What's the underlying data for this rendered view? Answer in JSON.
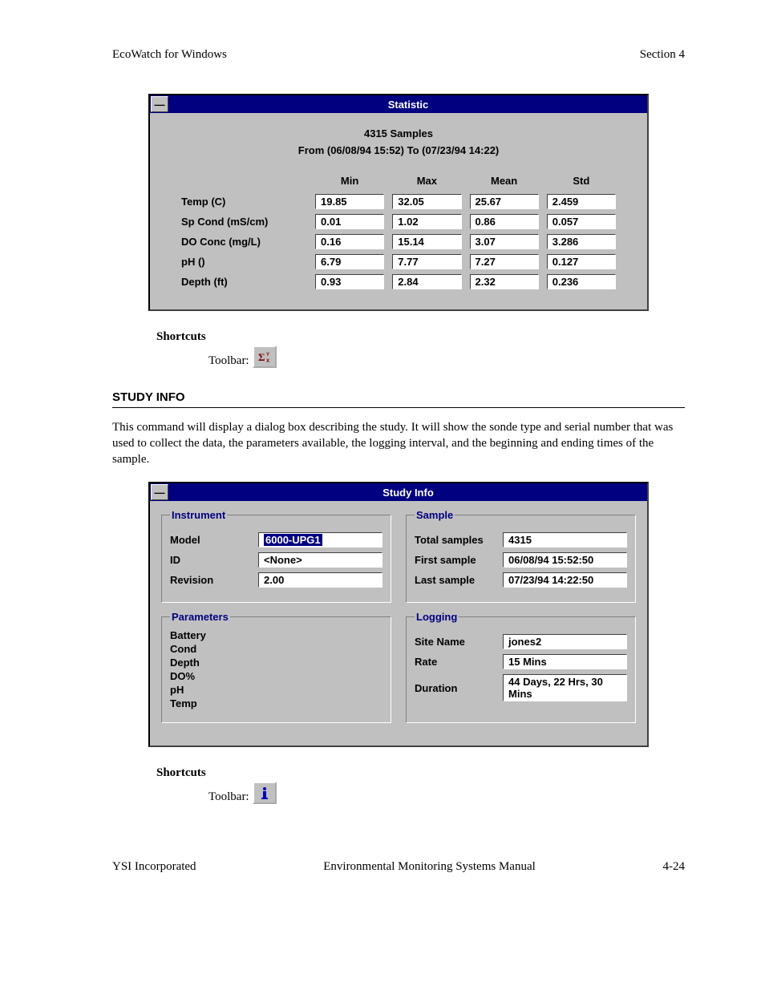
{
  "page": {
    "header_left": "EcoWatch for Windows",
    "header_right": "Section 4",
    "footer_left": "YSI Incorporated",
    "footer_center": "Environmental Monitoring Systems Manual",
    "footer_right": "4-24"
  },
  "statistic_dialog": {
    "title": "Statistic",
    "summary_line1": "4315 Samples",
    "summary_line2": "From (06/08/94 15:52) To (07/23/94 14:22)",
    "cols": {
      "min": "Min",
      "max": "Max",
      "mean": "Mean",
      "std": "Std"
    },
    "rows": [
      {
        "label": "Temp (C)",
        "min": "19.85",
        "max": "32.05",
        "mean": "25.67",
        "std": "2.459"
      },
      {
        "label": "Sp Cond (mS/cm)",
        "min": "0.01",
        "max": "1.02",
        "mean": "0.86",
        "std": "0.057"
      },
      {
        "label": "DO Conc (mg/L)",
        "min": "0.16",
        "max": "15.14",
        "mean": "3.07",
        "std": "3.286"
      },
      {
        "label": "pH ()",
        "min": "6.79",
        "max": "7.77",
        "mean": "7.27",
        "std": "0.127"
      },
      {
        "label": "Depth (ft)",
        "min": "0.93",
        "max": "2.84",
        "mean": "2.32",
        "std": "0.236"
      }
    ]
  },
  "shortcut1": {
    "heading": "Shortcuts",
    "label": "Toolbar:"
  },
  "section_study_info": {
    "heading": "STUDY INFO",
    "text": "This command will display a dialog box describing the study.  It will show the sonde type and serial number that was used to collect the data, the parameters available, the logging interval, and the beginning and ending times of the sample."
  },
  "study_info_dialog": {
    "title": "Study Info",
    "instrument": {
      "legend": "Instrument",
      "model_label": "Model",
      "model_value": "6000-UPG1",
      "id_label": "ID",
      "id_value": "<None>",
      "revision_label": "Revision",
      "revision_value": "2.00"
    },
    "sample": {
      "legend": "Sample",
      "total_label": "Total samples",
      "total_value": "4315",
      "first_label": "First sample",
      "first_value": "06/08/94 15:52:50",
      "last_label": "Last sample",
      "last_value": "07/23/94 14:22:50"
    },
    "parameters": {
      "legend": "Parameters",
      "items": [
        "Battery",
        "Cond",
        "Depth",
        "DO%",
        "pH",
        "Temp"
      ]
    },
    "logging": {
      "legend": "Logging",
      "site_label": "Site Name",
      "site_value": "jones2",
      "rate_label": "Rate",
      "rate_value": "15 Mins",
      "duration_label": "Duration",
      "duration_value": "44 Days, 22 Hrs, 30 Mins"
    }
  },
  "shortcut2": {
    "heading": "Shortcuts",
    "label": "Toolbar:"
  }
}
